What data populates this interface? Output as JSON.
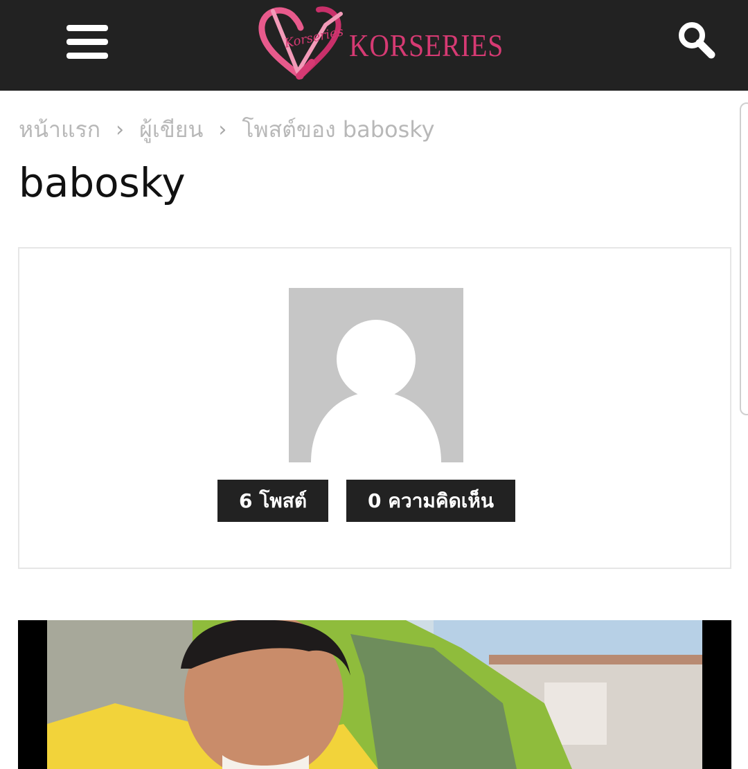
{
  "header": {
    "logo_text": "KORSERIES",
    "logo_script": "Korseries",
    "menu_icon": "hamburger-menu-icon",
    "search_icon": "magnifier-icon",
    "background": "#222222",
    "brand_color": "#d63a73"
  },
  "breadcrumb": {
    "items": [
      "หน้าแรก",
      "ผู้เขียน",
      "โพสต์ของ babosky"
    ],
    "separator": "›"
  },
  "page_title": "babosky",
  "author": {
    "avatar_icon": "default-user-avatar-icon",
    "posts_label": "6 โพสต์",
    "comments_label": "0 ความคิดเห็น"
  },
  "post_image": {
    "icon": "featured-post-image"
  }
}
